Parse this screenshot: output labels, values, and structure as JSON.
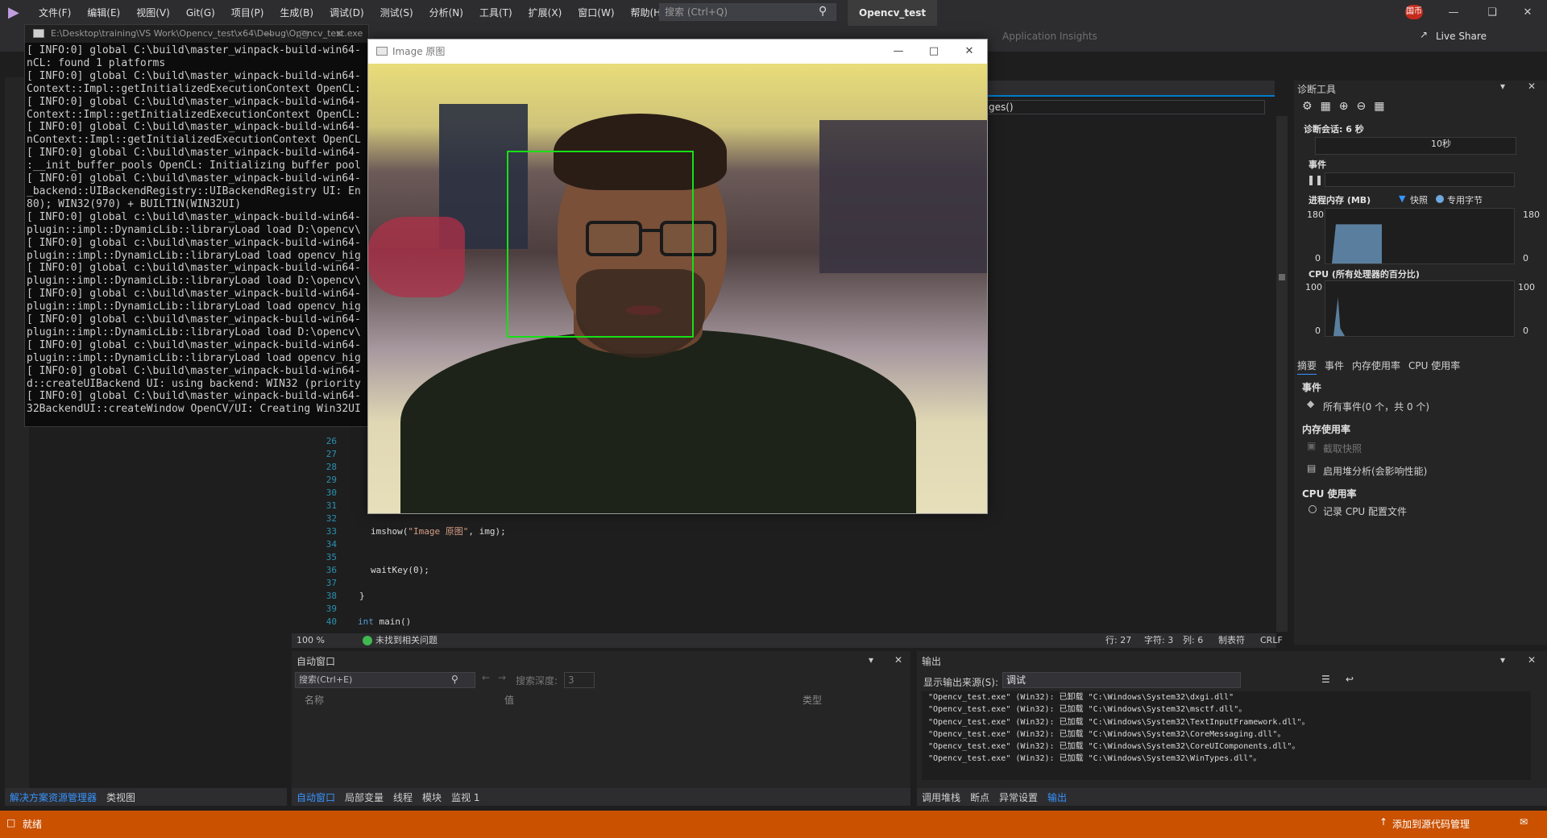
{
  "menubar": {
    "items": [
      "文件(F)",
      "编辑(E)",
      "视图(V)",
      "Git(G)",
      "项目(P)",
      "生成(B)",
      "调试(D)",
      "测试(S)",
      "分析(N)",
      "工具(T)",
      "扩展(X)",
      "窗口(W)",
      "帮助(H)"
    ],
    "search_placeholder": "搜索 (Ctrl+Q)",
    "project_name": "Opencv_test",
    "user_badge": "国币"
  },
  "toolbar": {
    "app_insights": "Application Insights",
    "live_share": "Live Share"
  },
  "console": {
    "title": "E:\\Desktop\\training\\VS Work\\Opencv_test\\x64\\Debug\\Opencv_test.exe",
    "lines": [
      "[ INFO:0] global C:\\build\\master_winpack-build-win64-",
      "nCL: found 1 platforms",
      "[ INFO:0] global C:\\build\\master_winpack-build-win64-",
      "Context::Impl::getInitializedExecutionContext OpenCL:",
      "[ INFO:0] global C:\\build\\master_winpack-build-win64-",
      "Context::Impl::getInitializedExecutionContext OpenCL:",
      "[ INFO:0] global C:\\build\\master_winpack-build-win64-",
      "nContext::Impl::getInitializedExecutionContext OpenCL",
      "[ INFO:0] global C:\\build\\master_winpack-build-win64-",
      ":__init_buffer_pools OpenCL: Initializing buffer pool",
      "[ INFO:0] global C:\\build\\master_winpack-build-win64-",
      "_backend::UIBackendRegistry::UIBackendRegistry UI: En",
      "80); WIN32(970) + BUILTIN(WIN32UI)",
      "[ INFO:0] global c:\\build\\master_winpack-build-win64-",
      "plugin::impl::DynamicLib::libraryLoad load D:\\opencv\\",
      "[ INFO:0] global c:\\build\\master_winpack-build-win64-",
      "plugin::impl::DynamicLib::libraryLoad load opencv_hig",
      "[ INFO:0] global c:\\build\\master_winpack-build-win64-",
      "plugin::impl::DynamicLib::libraryLoad load D:\\opencv\\",
      "[ INFO:0] global c:\\build\\master_winpack-build-win64-",
      "plugin::impl::DynamicLib::libraryLoad load opencv_hig",
      "[ INFO:0] global c:\\build\\master_winpack-build-win64-",
      "plugin::impl::DynamicLib::libraryLoad load D:\\opencv\\",
      "[ INFO:0] global c:\\build\\master_winpack-build-win64-",
      "plugin::impl::DynamicLib::libraryLoad load opencv_hig",
      "[ INFO:0] global C:\\build\\master_winpack-build-win64-",
      "d::createUIBackend UI: using backend: WIN32 (priority",
      "[ INFO:0] global C:\\build\\master_winpack-build-win64-",
      "32BackendUI::createWindow OpenCV/UI: Creating Win32UI"
    ]
  },
  "image_window": {
    "title": "Image 原图"
  },
  "editor": {
    "nav_right": "ges()",
    "line_numbers": [
      "26",
      "27",
      "28",
      "29",
      "30",
      "31",
      "32",
      "33",
      "34",
      "35",
      "36",
      "37",
      "38",
      "39",
      "40"
    ],
    "code": {
      "l33_fn": "imshow(",
      "l33_str": "\"Image 原图\"",
      "l33_rest": ", img);",
      "l36": "waitKey(0);",
      "l38": "}",
      "l40_kw": "int",
      "l40_rest": " main()"
    },
    "status": {
      "zoom": "100 %",
      "issues": "未找到相关问题",
      "line": "行: 27",
      "char": "字符: 3",
      "col": "列: 6",
      "tabs": "制表符",
      "eol": "CRLF"
    }
  },
  "diagnostics": {
    "title": "诊断工具",
    "session": "诊断会话: 6 秒",
    "timeline_label": "10秒",
    "events_header": "事件",
    "memory_header": "进程内存 (MB)",
    "memory_legend_snapshot": "快照",
    "memory_legend_private": "专用字节",
    "memory_max": "180",
    "memory_min": "0",
    "cpu_header": "CPU (所有处理器的百分比)",
    "cpu_max": "100",
    "cpu_min": "0",
    "tabs": [
      "摘要",
      "事件",
      "内存使用率",
      "CPU 使用率"
    ],
    "section_events": "事件",
    "all_events": "所有事件(0 个，共 0 个)",
    "section_memory": "内存使用率",
    "take_snapshot": "截取快照",
    "heap_profiling": "启用堆分析(会影响性能)",
    "section_cpu": "CPU 使用率",
    "record_cpu": "记录 CPU 配置文件"
  },
  "autos": {
    "title": "自动窗口",
    "search_placeholder": "搜索(Ctrl+E)",
    "search_depth_label": "搜索深度:",
    "search_depth_value": "3",
    "col_name": "名称",
    "col_value": "值",
    "col_type": "类型",
    "tabs": [
      "自动窗口",
      "局部变量",
      "线程",
      "模块",
      "监视 1"
    ]
  },
  "output": {
    "title": "输出",
    "source_label": "显示输出来源(S):",
    "source_value": "调试",
    "lines": [
      "\"Opencv_test.exe\" (Win32): 已卸载 \"C:\\Windows\\System32\\dxgi.dll\"",
      "\"Opencv_test.exe\" (Win32): 已加载 \"C:\\Windows\\System32\\msctf.dll\"。",
      "\"Opencv_test.exe\" (Win32): 已加载 \"C:\\Windows\\System32\\TextInputFramework.dll\"。",
      "\"Opencv_test.exe\" (Win32): 已加载 \"C:\\Windows\\System32\\CoreMessaging.dll\"。",
      "\"Opencv_test.exe\" (Win32): 已加载 \"C:\\Windows\\System32\\CoreUIComponents.dll\"。",
      "\"Opencv_test.exe\" (Win32): 已加载 \"C:\\Windows\\System32\\WinTypes.dll\"。"
    ],
    "tabs": [
      "调用堆栈",
      "断点",
      "异常设置",
      "输出"
    ]
  },
  "left_tabs": [
    "解决方案资源管理器",
    "类视图"
  ],
  "statusbar": {
    "text": "就绪",
    "source_control": "添加到源代码管理"
  }
}
